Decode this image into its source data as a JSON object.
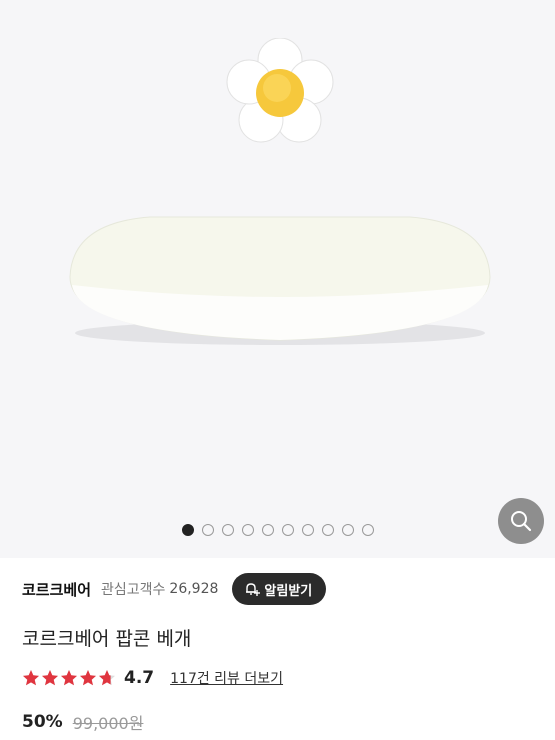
{
  "brand": {
    "name": "코르크베어",
    "fav_label": "관심고객수",
    "fav_count": "26,928",
    "alarm_label": "알림받기"
  },
  "product": {
    "title": "코르크베어 팝콘 베개"
  },
  "rating": {
    "score": "4.7",
    "stars": 4.7,
    "review_link": "117건 리뷰 더보기"
  },
  "price": {
    "discount": "50%",
    "original": "99,000원"
  },
  "gallery": {
    "total_images": 10,
    "current_index": 0
  },
  "colors": {
    "star": "#e0353f",
    "button_dark": "#2b2b2b",
    "zoom_bg": "#8e8e8e"
  },
  "icons": {
    "zoom": "search-icon",
    "alarm": "bell-plus-icon",
    "star": "star-icon"
  }
}
